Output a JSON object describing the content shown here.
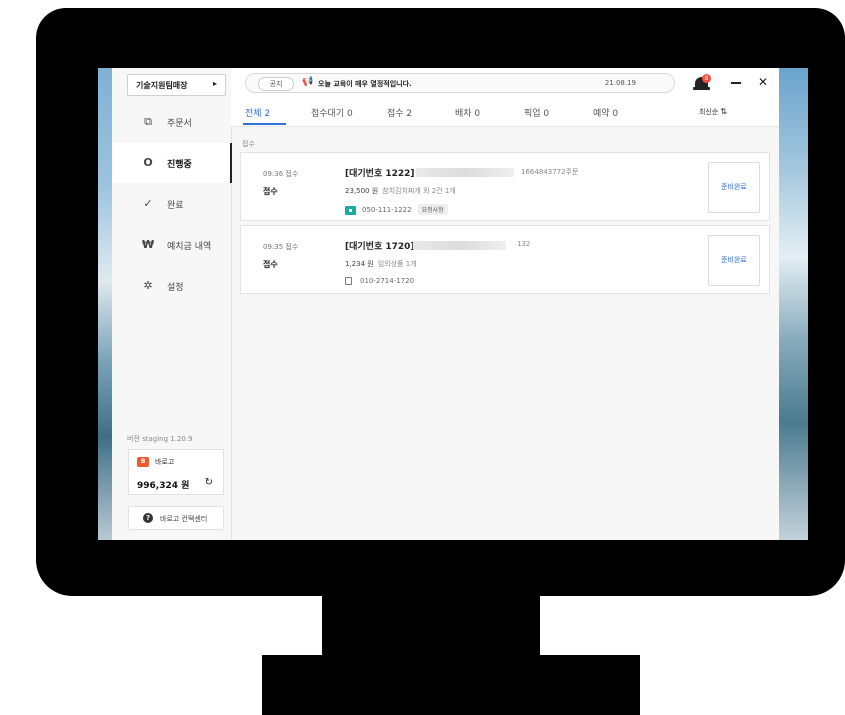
{
  "sidebar": {
    "store_name": "기술지원팀매장",
    "items": [
      {
        "label": "주문서",
        "icon": "document-icon"
      },
      {
        "label": "진행중",
        "icon": "circle-progress-icon"
      },
      {
        "label": "완료",
        "icon": "check-icon"
      },
      {
        "label": "예치금 내역",
        "icon": "won-icon"
      },
      {
        "label": "설정",
        "icon": "gear-icon"
      }
    ],
    "active_item": "진행중",
    "version": "버전 staging 1.20.9",
    "brand": {
      "badge": "B",
      "name": "바로고",
      "color": "#ef5a2a"
    },
    "balance": "996,324 원",
    "support_label": "바로고 컨택센터"
  },
  "notice": {
    "tag": "공지",
    "text": "오늘 교육이 매우 열정적입니다.",
    "date": "21.08.19"
  },
  "notifications": {
    "count": "8"
  },
  "tabs": [
    {
      "label": "전체 2",
      "active": true
    },
    {
      "label": "접수대기 0"
    },
    {
      "label": "접수 2"
    },
    {
      "label": "배차 0"
    },
    {
      "label": "픽업 0"
    },
    {
      "label": "예약 0"
    }
  ],
  "sort_label": "최신순",
  "section_label": "접수",
  "orders": [
    {
      "time": "09:36 접수",
      "status": "접수",
      "wait_no": "[대기번호 1222]",
      "order_code": "1664843772주문",
      "price": "23,500 원",
      "menu": "참치김치찌개 외 2건 1개",
      "phone": "050-111-1222",
      "request_badge": "요청사항",
      "payment_icon": "payment-card-icon",
      "action": "준비완료"
    },
    {
      "time": "09:35 접수",
      "status": "접수",
      "wait_no": "[대기번호 1720]",
      "order_code": "132",
      "price": "1,234 원",
      "menu": "임의상품 1개",
      "phone": "010-2714-1720",
      "phone_icon": "copy-icon",
      "action": "준비완료"
    }
  ],
  "colors": {
    "accent": "#2f6fd8",
    "notification": "#f04a3a"
  }
}
